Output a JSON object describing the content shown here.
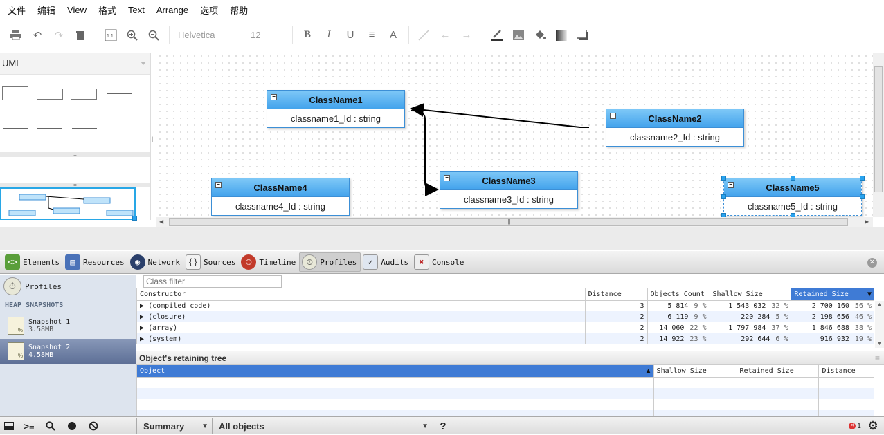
{
  "menu": [
    "文件",
    "编辑",
    "View",
    "格式",
    "Text",
    "Arrange",
    "选项",
    "帮助"
  ],
  "toolbar": {
    "font": "Helvetica",
    "font_size": "12",
    "icons_left": [
      "print-icon",
      "undo-icon",
      "redo-icon",
      "delete-icon",
      "actual-size-icon",
      "zoom-in-icon",
      "zoom-out-icon"
    ],
    "icons_text": [
      "bold-icon",
      "italic-icon",
      "underline-icon",
      "align-icon",
      "font-color-icon"
    ],
    "icons_conn": [
      "line-icon",
      "arrow-left-icon",
      "arrow-right-icon"
    ],
    "icons_style": [
      "line-color-icon",
      "image-icon",
      "fill-color-icon",
      "gradient-icon",
      "shadow-icon"
    ]
  },
  "sidebar_panel": {
    "title": "UML"
  },
  "diagram": {
    "classes": [
      {
        "name": "ClassName1",
        "attr": "classname1_Id : string"
      },
      {
        "name": "ClassName2",
        "attr": "classname2_Id : string"
      },
      {
        "name": "ClassName3",
        "attr": "classname3_Id : string"
      },
      {
        "name": "ClassName4",
        "attr": "classname4_Id : string"
      },
      {
        "name": "ClassName5",
        "attr": "classname5_Id : string"
      }
    ]
  },
  "devtools": {
    "tabs": [
      "Elements",
      "Resources",
      "Network",
      "Sources",
      "Timeline",
      "Profiles",
      "Audits",
      "Console"
    ],
    "selected_tab": "Profiles",
    "sidebar": {
      "profiles_label": "Profiles",
      "section": "HEAP SNAPSHOTS",
      "snapshots": [
        {
          "name": "Snapshot 1",
          "size": "3.58MB"
        },
        {
          "name": "Snapshot 2",
          "size": "4.58MB"
        }
      ]
    },
    "filter_placeholder": "Class filter",
    "columns": [
      "Constructor",
      "Distance",
      "Objects Count",
      "Shallow Size",
      "Retained Size"
    ],
    "rows": [
      {
        "name": "(compiled code)",
        "distance": "3",
        "count": "5 814",
        "count_pct": "9 %",
        "shallow": "1 543 032",
        "shallow_pct": "32 %",
        "retained": "2 700 160",
        "retained_pct": "56 %"
      },
      {
        "name": "(closure)",
        "distance": "2",
        "count": "6 119",
        "count_pct": "9 %",
        "shallow": "220 284",
        "shallow_pct": "5 %",
        "retained": "2 198 656",
        "retained_pct": "46 %"
      },
      {
        "name": "(array)",
        "distance": "2",
        "count": "14 060",
        "count_pct": "22 %",
        "shallow": "1 797 984",
        "shallow_pct": "37 %",
        "retained": "1 846 688",
        "retained_pct": "38 %"
      },
      {
        "name": "(system)",
        "distance": "2",
        "count": "14 922",
        "count_pct": "23 %",
        "shallow": "292 644",
        "shallow_pct": "6 %",
        "retained": "916 932",
        "retained_pct": "19 %"
      }
    ],
    "retaining_title": "Object's retaining tree",
    "retaining_columns": [
      "Object",
      "Shallow Size",
      "Retained Size",
      "Distance"
    ],
    "bottom": {
      "view": "Summary",
      "filter": "All objects",
      "help": "?",
      "error_count": "1"
    }
  }
}
